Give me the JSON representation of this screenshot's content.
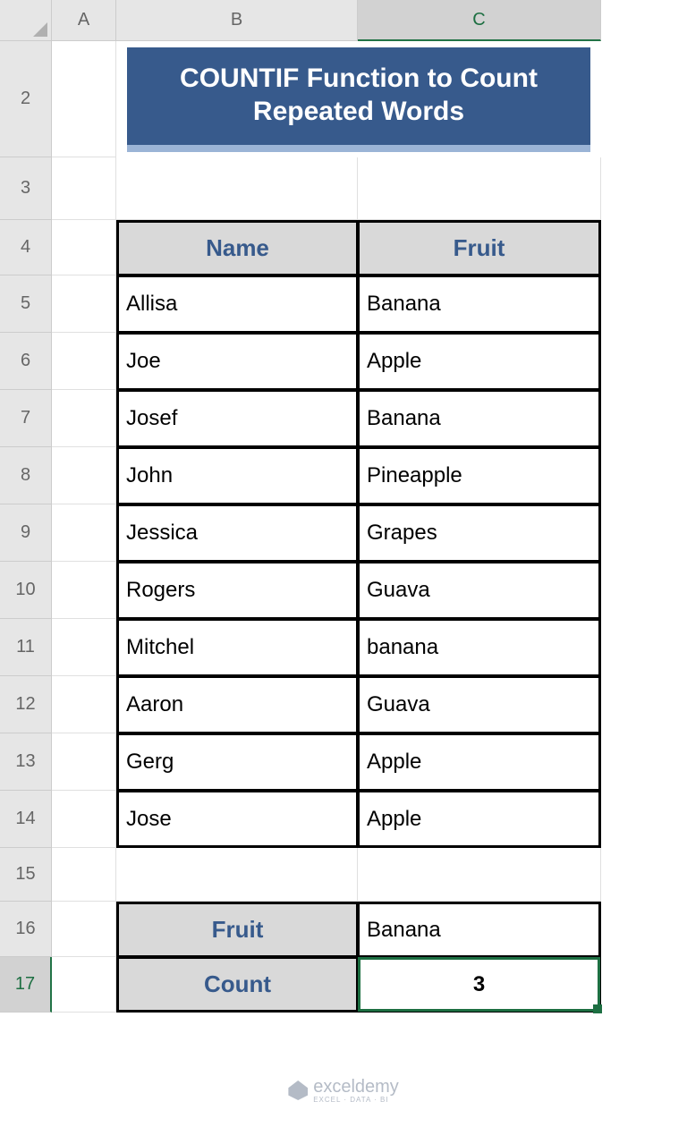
{
  "columns": [
    "A",
    "B",
    "C"
  ],
  "rows": [
    "2",
    "3",
    "4",
    "5",
    "6",
    "7",
    "8",
    "9",
    "10",
    "11",
    "12",
    "13",
    "14",
    "15",
    "16",
    "17"
  ],
  "title": "COUNTIF Function to Count Repeated Words",
  "table": {
    "headers": {
      "name": "Name",
      "fruit": "Fruit"
    },
    "rows": [
      {
        "name": "Allisa",
        "fruit": "Banana"
      },
      {
        "name": "Joe",
        "fruit": "Apple"
      },
      {
        "name": "Josef",
        "fruit": "Banana"
      },
      {
        "name": "John",
        "fruit": "Pineapple"
      },
      {
        "name": "Jessica",
        "fruit": "Grapes"
      },
      {
        "name": "Rogers",
        "fruit": "Guava"
      },
      {
        "name": "Mitchel",
        "fruit": "banana"
      },
      {
        "name": "Aaron",
        "fruit": "Guava"
      },
      {
        "name": "Gerg",
        "fruit": "Apple"
      },
      {
        "name": "Jose",
        "fruit": "Apple"
      }
    ]
  },
  "summary": {
    "fruit_label": "Fruit",
    "fruit_value": "Banana",
    "count_label": "Count",
    "count_value": "3"
  },
  "watermark": {
    "brand": "exceldemy",
    "tagline": "EXCEL · DATA · BI"
  },
  "selected_cell": "C17"
}
